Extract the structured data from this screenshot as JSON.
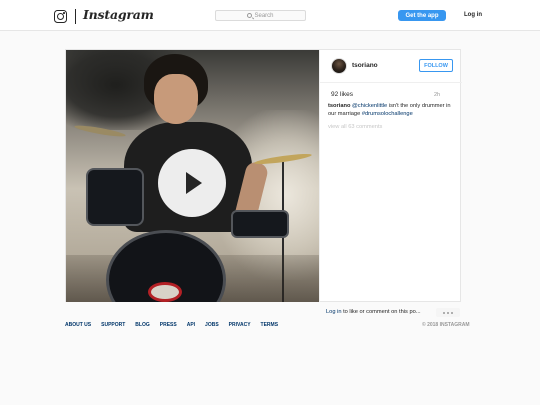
{
  "header": {
    "logo_icon": "instagram-camera-icon",
    "wordmark": "Instagram",
    "search_placeholder": "Search",
    "search_icon": "search-icon",
    "get_app_label": "Get the app",
    "login_label": "Log in"
  },
  "post": {
    "media_type": "video",
    "play_icon": "play-icon",
    "author": "tsoriano",
    "follow_label": "FOLLOW",
    "likes": "92 likes",
    "time": "2h",
    "caption": {
      "author": "tsoriano",
      "mention": "@chickenlittle",
      "text": " isn't the only drummer in our marriage ",
      "hashtag": "#drumsolochallenge"
    },
    "view_comments": "view all 63 comments",
    "login_prompt": {
      "link": "Log in",
      "text": " to like or comment on this po..."
    },
    "more_icon": "more-options-icon"
  },
  "footer": {
    "links": [
      "ABOUT US",
      "SUPPORT",
      "BLOG",
      "PRESS",
      "API",
      "JOBS",
      "PRIVACY",
      "TERMS"
    ],
    "copyright": "© 2018 INSTAGRAM"
  },
  "colors": {
    "accent": "#3897f0",
    "link": "#003569",
    "background": "#fafafa"
  }
}
